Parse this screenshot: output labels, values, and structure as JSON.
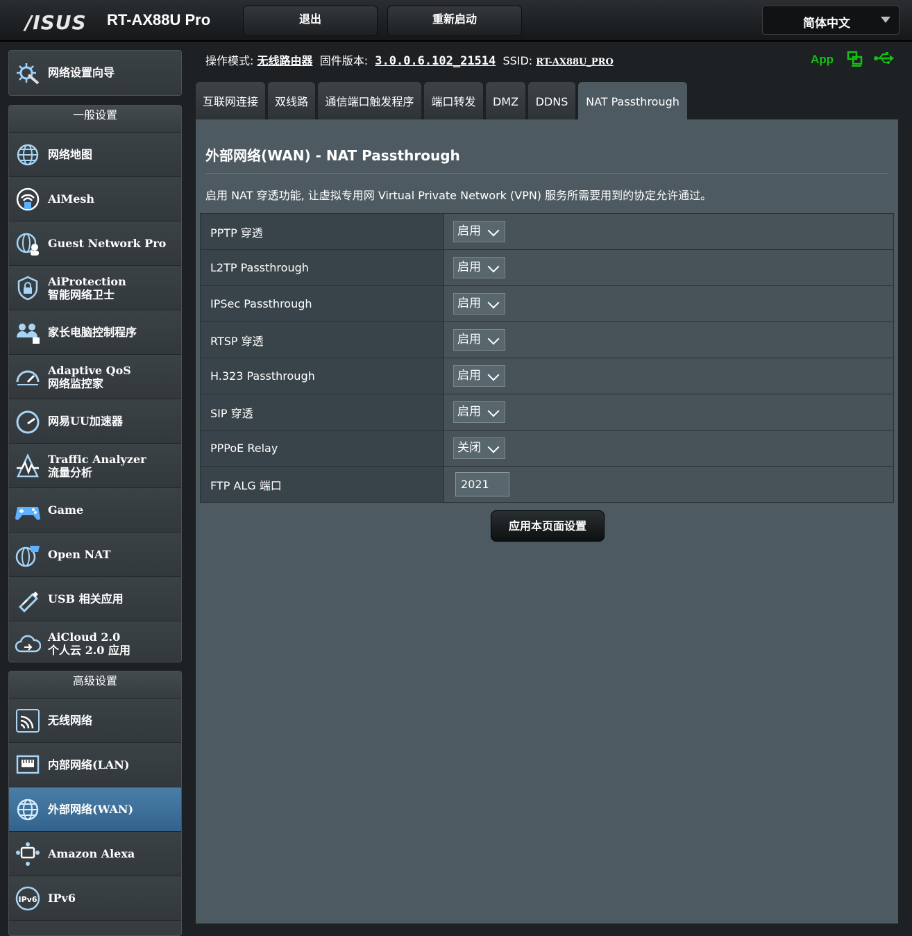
{
  "header": {
    "logo": "/ISUS",
    "model": "RT-AX88U Pro",
    "logout_label": "退出",
    "reboot_label": "重新启动",
    "language": "简体中文"
  },
  "info": {
    "mode_label": "操作模式:",
    "mode_value": "无线路由器",
    "firmware_label": "固件版本:",
    "firmware_value": "3.0.0.6.102_21514",
    "ssid_label": "SSID:",
    "ssid_value": "RT-AX88U_PRO",
    "app_label": "App"
  },
  "sidebar": {
    "wizard": "网络设置向导",
    "general_title": "一般设置",
    "general_items": [
      {
        "l1": "网络地图",
        "l2": ""
      },
      {
        "l1": "AiMesh",
        "l2": ""
      },
      {
        "l1": "Guest Network Pro",
        "l2": ""
      },
      {
        "l1": "AiProtection",
        "l2": "智能网络卫士"
      },
      {
        "l1": "家长电脑控制程序",
        "l2": ""
      },
      {
        "l1": "Adaptive QoS",
        "l2": "网络监控家"
      },
      {
        "l1": "网易UU加速器",
        "l2": ""
      },
      {
        "l1": "Traffic Analyzer",
        "l2": "流量分析"
      },
      {
        "l1": "Game",
        "l2": ""
      },
      {
        "l1": "Open NAT",
        "l2": ""
      },
      {
        "l1": "USB 相关应用",
        "l2": ""
      },
      {
        "l1": "AiCloud 2.0",
        "l2": "个人云 2.0 应用"
      }
    ],
    "advanced_title": "高级设置",
    "advanced_items": [
      {
        "l1": "无线网络"
      },
      {
        "l1": "内部网络(LAN)"
      },
      {
        "l1": "外部网络(WAN)"
      },
      {
        "l1": "Amazon Alexa"
      },
      {
        "l1": "IPv6"
      }
    ]
  },
  "tabs": [
    "互联网连接",
    "双线路",
    "通信端口触发程序",
    "端口转发",
    "DMZ",
    "DDNS",
    "NAT Passthrough"
  ],
  "main": {
    "title": "外部网络(WAN) - NAT Passthrough",
    "description": "启用 NAT 穿透功能, 让虚拟专用网 Virtual Private Network (VPN) 服务所需要用到的协定允许通过。",
    "rows": [
      {
        "label": "PPTP 穿透",
        "value": "启用"
      },
      {
        "label": "L2TP Passthrough",
        "value": "启用"
      },
      {
        "label": "IPSec Passthrough",
        "value": "启用"
      },
      {
        "label": "RTSP 穿透",
        "value": "启用"
      },
      {
        "label": "H.323 Passthrough",
        "value": "启用"
      },
      {
        "label": "SIP 穿透",
        "value": "启用"
      },
      {
        "label": "PPPoE Relay",
        "value": "关闭"
      },
      {
        "label": "FTP ALG 端口",
        "value": "2021"
      }
    ],
    "apply_label": "应用本页面设置"
  },
  "colors": {
    "panel": "#4d5a61",
    "active_menu": "#3a6d96",
    "app_green": "#13c113"
  }
}
